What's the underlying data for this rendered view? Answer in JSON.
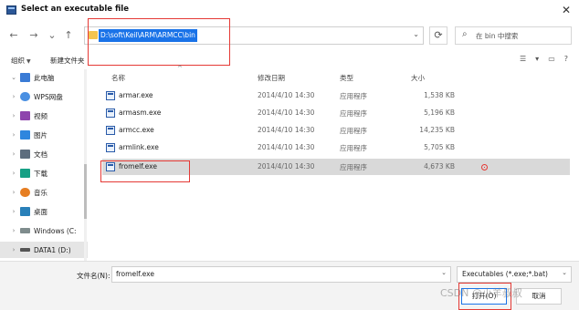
{
  "window": {
    "title": "Select an executable file",
    "close_glyph": "✕"
  },
  "nav": {
    "back_glyph": "←",
    "forward_glyph": "→",
    "down_glyph": "⌄",
    "up_glyph": "↑",
    "address_path": "D:\\soft\\Keil\\ARM\\ARMCC\\bin",
    "refresh_glyph": "⟳",
    "search_placeholder": "在 bin 中搜索",
    "search_icon": "search-icon"
  },
  "toolbar": {
    "organize_label": "组织",
    "new_folder_label": "新建文件夹",
    "view_icons": [
      "view-list-icon",
      "view-toggle-icon",
      "help-icon"
    ]
  },
  "sidebar": {
    "items": [
      {
        "label": "此电脑",
        "icon": "computer-icon",
        "color": "#3a7bd5"
      },
      {
        "label": "WPS网盘",
        "icon": "cloud-icon",
        "color": "#4a90e2"
      },
      {
        "label": "视频",
        "icon": "video-icon",
        "color": "#8e44ad"
      },
      {
        "label": "图片",
        "icon": "image-icon",
        "color": "#2e86de"
      },
      {
        "label": "文档",
        "icon": "document-icon",
        "color": "#5d6d7e"
      },
      {
        "label": "下载",
        "icon": "download-icon",
        "color": "#16a085"
      },
      {
        "label": "音乐",
        "icon": "music-icon",
        "color": "#e67e22"
      },
      {
        "label": "桌面",
        "icon": "desktop-icon",
        "color": "#2980b9"
      },
      {
        "label": "Windows (C:",
        "icon": "drive-icon",
        "color": "#7f8c8d"
      },
      {
        "label": "DATA1 (D:)",
        "icon": "drive-icon",
        "color": "#555555"
      }
    ]
  },
  "table": {
    "headers": {
      "name": "名称",
      "date": "修改日期",
      "type": "类型",
      "size": "大小"
    },
    "rows": [
      {
        "name": "armar.exe",
        "date": "2014/4/10 14:30",
        "type": "应用程序",
        "size": "1,538 KB"
      },
      {
        "name": "armasm.exe",
        "date": "2014/4/10 14:30",
        "type": "应用程序",
        "size": "5,196 KB"
      },
      {
        "name": "armcc.exe",
        "date": "2014/4/10 14:30",
        "type": "应用程序",
        "size": "14,235 KB"
      },
      {
        "name": "armlink.exe",
        "date": "2014/4/10 14:30",
        "type": "应用程序",
        "size": "5,705 KB"
      },
      {
        "name": "fromelf.exe",
        "date": "2014/4/10 14:30",
        "type": "应用程序",
        "size": "4,673 KB"
      }
    ]
  },
  "footer": {
    "filename_label": "文件名(N):",
    "filename_value": "fromelf.exe",
    "filter_value": "Executables (*.exe;*.bat)",
    "open_label": "打开(O)",
    "cancel_label": "取消"
  },
  "watermark": "CSDN @小羊叔叔",
  "colors": {
    "accent": "#1a73e8",
    "annotation": "#e53935",
    "selection": "#d9d9d9"
  }
}
